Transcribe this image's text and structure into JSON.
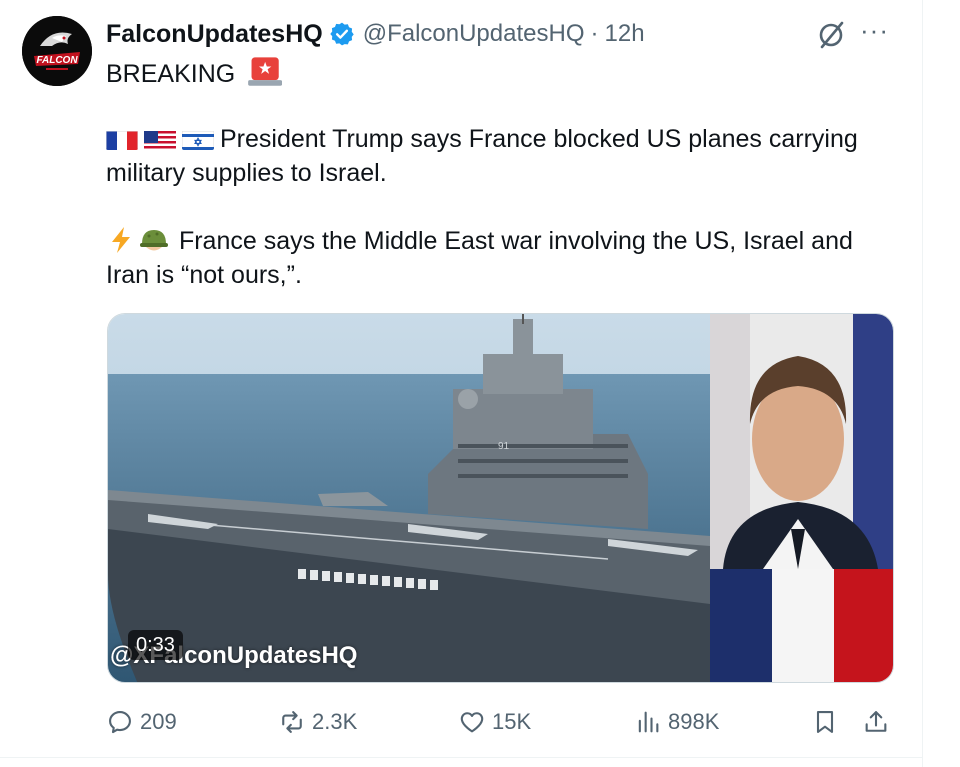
{
  "post": {
    "display_name": "FalconUpdatesHQ",
    "handle": "@FalconUpdatesHQ",
    "separator": "·",
    "time": "12h",
    "more_label": "···",
    "avatar_text": "FALCON",
    "line1": "BREAKING",
    "para1": "President Trump says France blocked US planes carrying military supplies to Israel.",
    "para2": "France says the Middle East war involving the US, Israel and Iran is “not ours,”."
  },
  "media": {
    "duration": "0:33",
    "watermark": "@XFalconUpdatesHQ",
    "ship_hull_number": "91"
  },
  "actions": {
    "replies": "209",
    "reposts": "2.3K",
    "likes": "15K",
    "views": "898K"
  },
  "icons": [
    "verified-badge-icon",
    "grok-icon",
    "more-icon",
    "siren-icon",
    "flag-france-icon",
    "flag-us-icon",
    "flag-israel-icon",
    "lightning-icon",
    "helmet-icon",
    "reply-icon",
    "repost-icon",
    "like-icon",
    "views-icon",
    "bookmark-icon",
    "share-icon"
  ],
  "colors": {
    "accent": "#1d9bf0",
    "text": "#0f1419",
    "muted": "#536471"
  }
}
